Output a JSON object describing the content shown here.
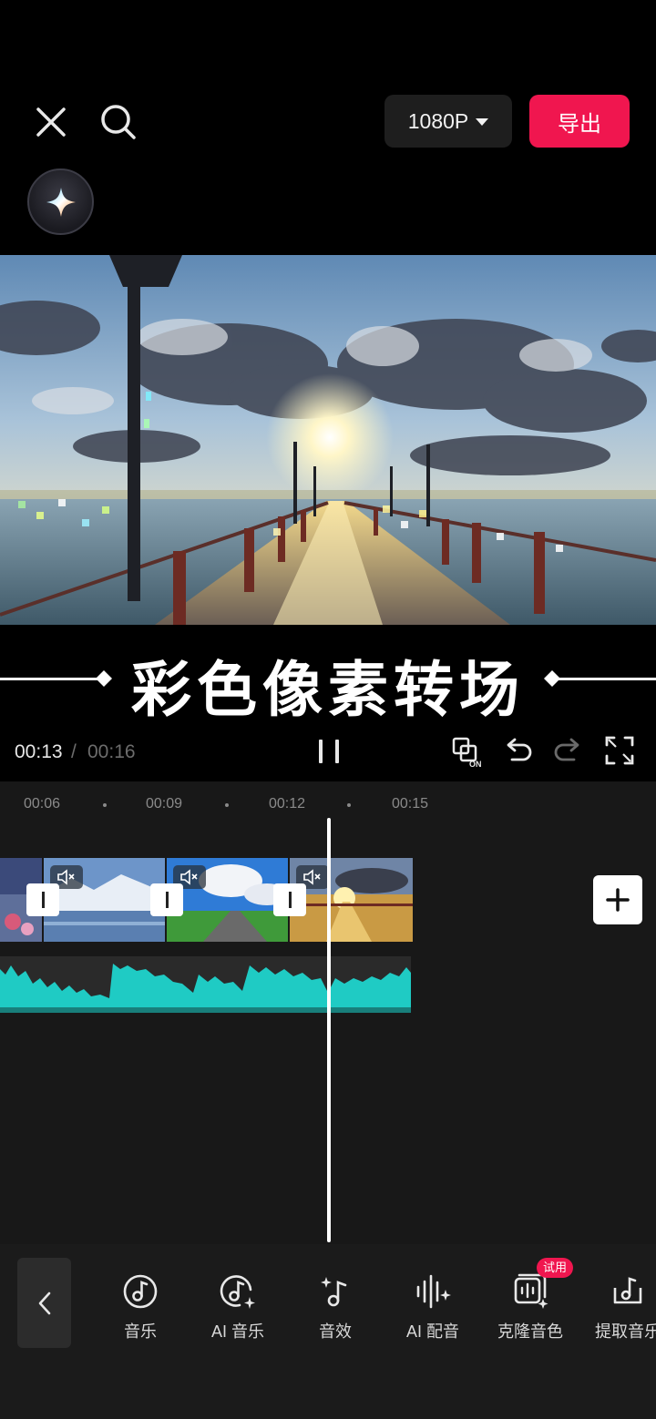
{
  "header": {
    "resolution_label": "1080P",
    "export_label": "导出"
  },
  "preview": {
    "caption": "彩色像素转场"
  },
  "playback": {
    "current_time": "00:13",
    "separator": "/",
    "total_time": "00:16"
  },
  "timeline": {
    "ticks": [
      "00:06",
      "00:09",
      "00:12",
      "00:15"
    ]
  },
  "toolbar": {
    "items": [
      {
        "label": "音乐",
        "icon": "music-note-icon"
      },
      {
        "label": "AI 音乐",
        "icon": "ai-music-icon"
      },
      {
        "label": "音效",
        "icon": "sound-effect-icon"
      },
      {
        "label": "AI 配音",
        "icon": "ai-voice-icon"
      },
      {
        "label": "克隆音色",
        "icon": "voice-clone-icon"
      },
      {
        "label": "提取音乐",
        "icon": "extract-music-icon"
      }
    ],
    "trial_badge": "试用"
  },
  "colors": {
    "accent": "#f0164f",
    "waveform": "#1fcbc4",
    "timeline_bg": "#181818",
    "toolbar_bg": "#1b1b1b"
  }
}
